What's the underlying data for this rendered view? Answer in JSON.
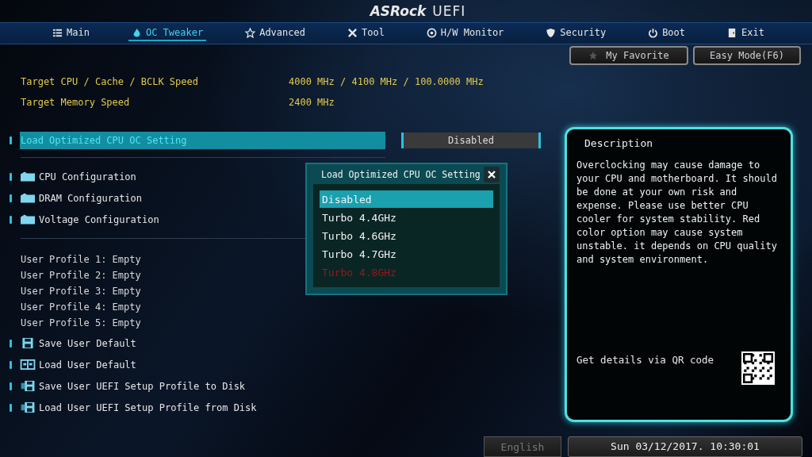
{
  "header": {
    "logo": "ASRock",
    "product": "UEFI"
  },
  "tabs": [
    {
      "label": "Main",
      "selected": false
    },
    {
      "label": "OC Tweaker",
      "selected": true
    },
    {
      "label": "Advanced",
      "selected": false
    },
    {
      "label": "Tool",
      "selected": false
    },
    {
      "label": "H/W Monitor",
      "selected": false
    },
    {
      "label": "Security",
      "selected": false
    },
    {
      "label": "Boot",
      "selected": false
    },
    {
      "label": "Exit",
      "selected": false
    }
  ],
  "top_buttons": [
    {
      "label": "My Favorite"
    },
    {
      "label": "Easy Mode(F6)"
    }
  ],
  "info": [
    {
      "label": "Target CPU / Cache / BCLK Speed",
      "value": "4000 MHz / 4100 MHz / 100.0000 MHz"
    },
    {
      "label": "Target Memory Speed",
      "value": "2400 MHz"
    }
  ],
  "setting": {
    "label": "Load Optimized CPU OC Setting",
    "value": "Disabled",
    "selected": true
  },
  "submenus": [
    {
      "label": "CPU Configuration"
    },
    {
      "label": "DRAM Configuration"
    },
    {
      "label": "Voltage Configuration"
    }
  ],
  "profiles": [
    "User Profile 1: Empty",
    "User Profile 2: Empty",
    "User Profile 3: Empty",
    "User Profile 4: Empty",
    "User Profile 5: Empty"
  ],
  "actions": [
    {
      "label": "Save User Default"
    },
    {
      "label": "Load User Default"
    },
    {
      "label": "Save User UEFI Setup Profile to Disk"
    },
    {
      "label": "Load User UEFI Setup Profile from Disk"
    }
  ],
  "popup": {
    "title": "Load Optimized CPU OC Setting",
    "options": [
      {
        "label": "Disabled",
        "selected": true,
        "warning": false
      },
      {
        "label": "Turbo 4.4GHz",
        "selected": false,
        "warning": false
      },
      {
        "label": "Turbo 4.6GHz",
        "selected": false,
        "warning": false
      },
      {
        "label": "Turbo 4.7GHz",
        "selected": false,
        "warning": false
      },
      {
        "label": "Turbo 4.8GHz",
        "selected": false,
        "warning": true
      }
    ]
  },
  "description": {
    "title": "Description",
    "text": "Overclocking may cause damage to your CPU and motherboard. It should be done at your own risk and expense. Please use better CPU cooler for system stability. Red color option may cause system unstable. it depends on CPU quality and system environment.",
    "qr_text": "Get details via QR code"
  },
  "footer": {
    "language": "English",
    "datetime": "Sun 03/12/2017. 10:30:01"
  }
}
